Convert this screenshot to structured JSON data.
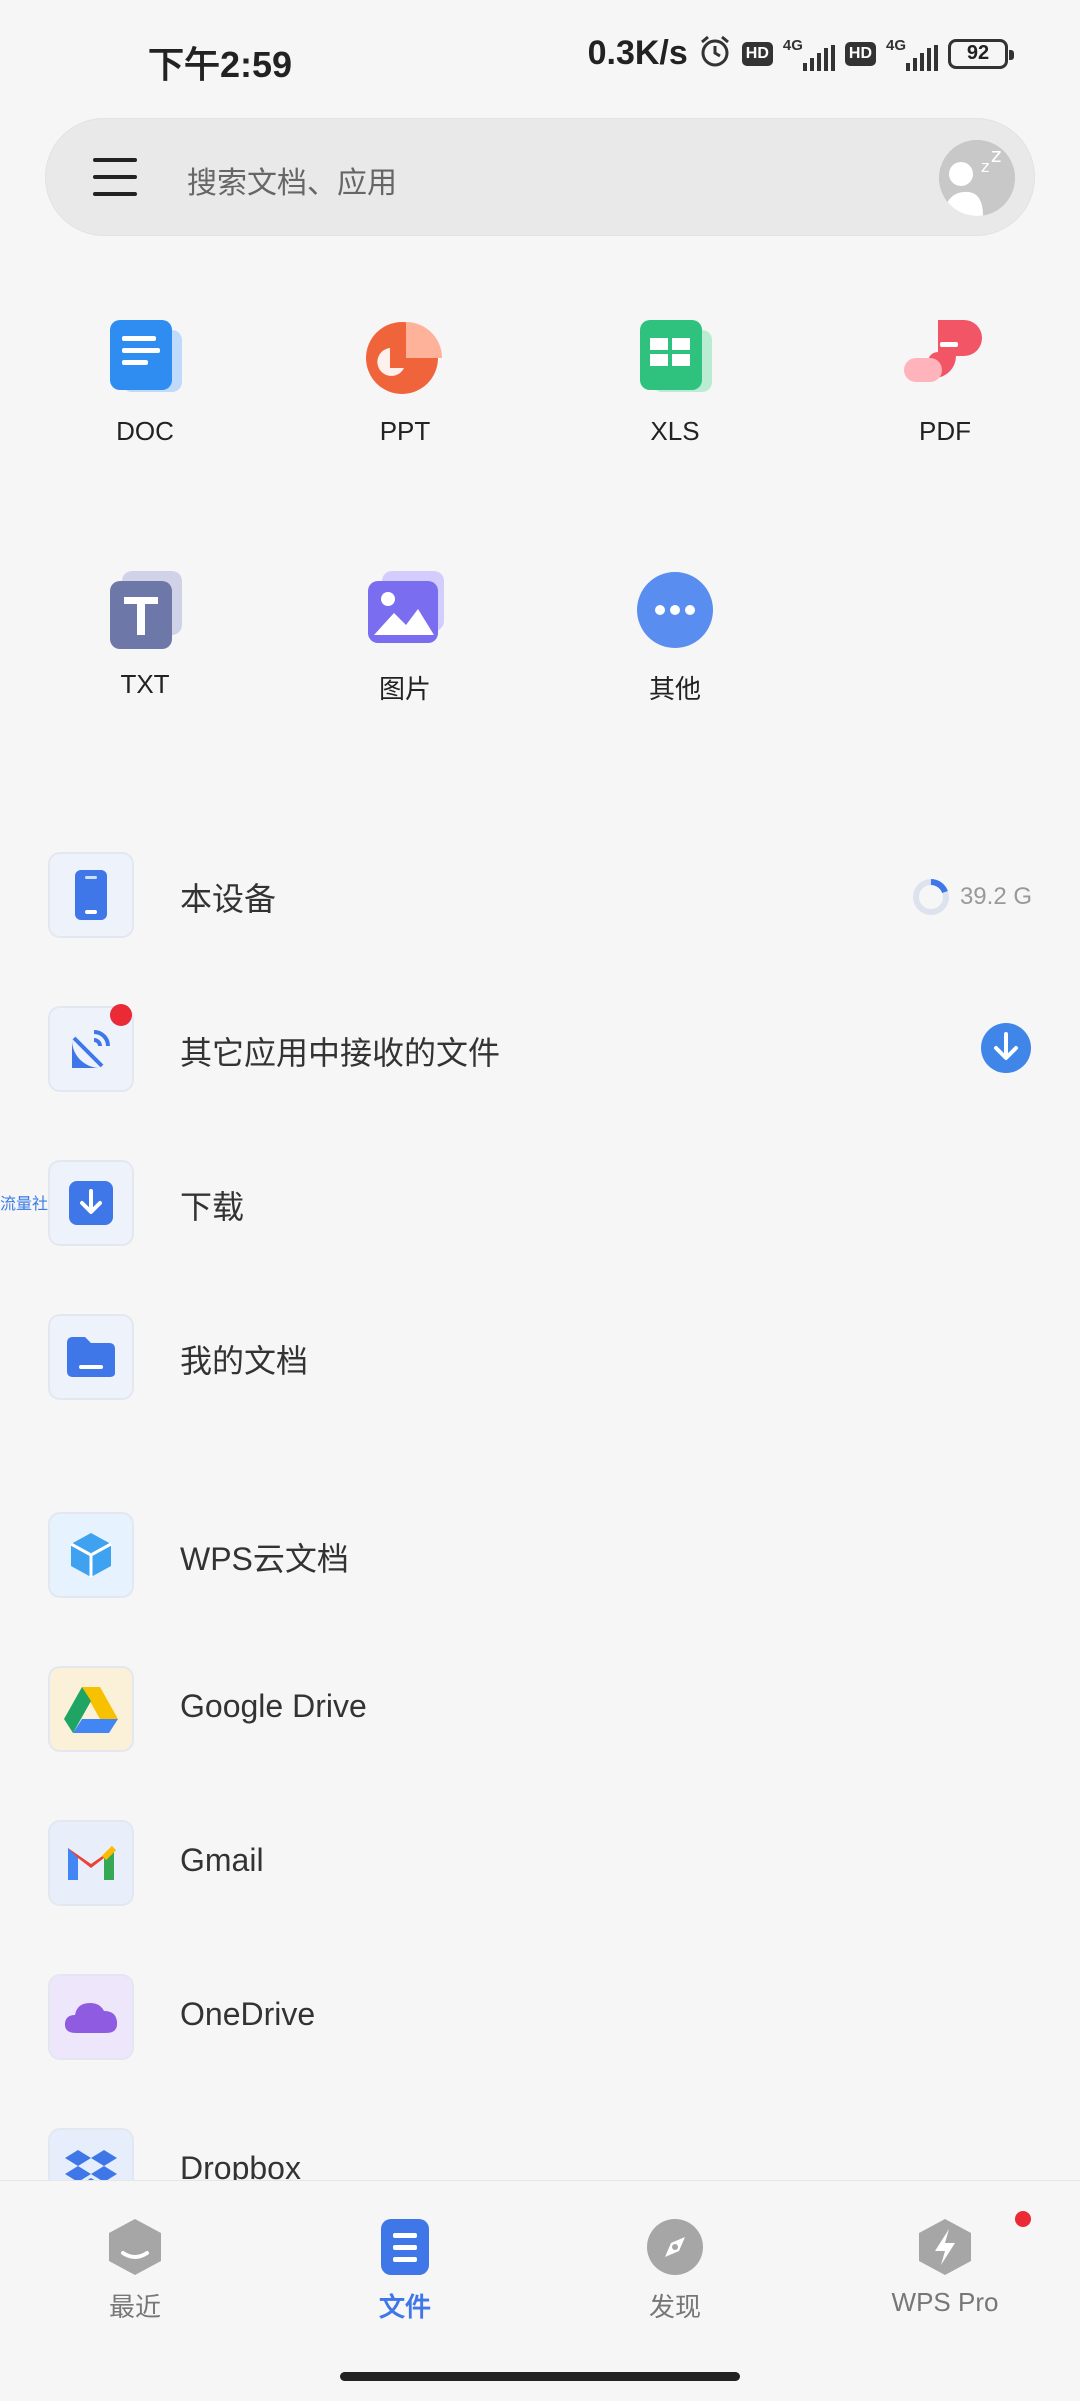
{
  "status_bar": {
    "time": "下午2:59",
    "net_speed": "0.3K/s",
    "hd_label": "HD",
    "network_label": "4G",
    "battery": "92"
  },
  "search": {
    "placeholder": "搜索文档、应用"
  },
  "file_types": [
    {
      "label": "DOC",
      "icon": "doc-icon",
      "color": "#2f8cf0"
    },
    {
      "label": "PPT",
      "icon": "ppt-icon",
      "color": "#f0643c"
    },
    {
      "label": "XLS",
      "icon": "xls-icon",
      "color": "#2ec27e"
    },
    {
      "label": "PDF",
      "icon": "pdf-icon",
      "color": "#f25566"
    },
    {
      "label": "TXT",
      "icon": "txt-icon",
      "color": "#6d77a8"
    },
    {
      "label": "图片",
      "icon": "image-icon",
      "color": "#7b6df0"
    },
    {
      "label": "其他",
      "icon": "more-icon",
      "color": "#5a8df0"
    }
  ],
  "locations": [
    {
      "label": "本设备",
      "icon": "phone-icon",
      "meta": "39.2 G"
    },
    {
      "label": "其它应用中接收的文件",
      "icon": "satellite-icon"
    },
    {
      "label": "下载",
      "icon": "download-icon"
    },
    {
      "label": "我的文档",
      "icon": "folder-icon"
    }
  ],
  "side_tag": "流量社区",
  "cloud": [
    {
      "label": "WPS云文档",
      "icon": "wps-cloud-icon"
    },
    {
      "label": "Google Drive",
      "icon": "google-drive-icon"
    },
    {
      "label": "Gmail",
      "icon": "gmail-icon"
    },
    {
      "label": "OneDrive",
      "icon": "onedrive-icon"
    },
    {
      "label": "Dropbox",
      "icon": "dropbox-icon"
    }
  ],
  "bottom_nav": [
    {
      "label": "最近",
      "icon": "recent-icon",
      "active": false
    },
    {
      "label": "文件",
      "icon": "files-icon",
      "active": true
    },
    {
      "label": "发现",
      "icon": "compass-icon",
      "active": false
    },
    {
      "label": "WPS Pro",
      "icon": "wps-pro-icon",
      "active": false
    }
  ],
  "colors": {
    "accent": "#3f76e8",
    "badge_red": "#ea2a35",
    "background": "#f6f6f6"
  }
}
